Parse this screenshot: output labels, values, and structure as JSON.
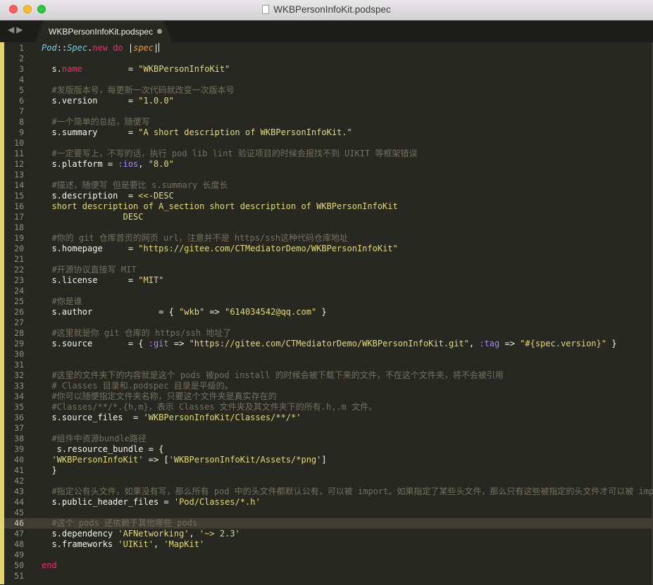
{
  "window": {
    "title": "WKBPersonInfoKit.podspec"
  },
  "tab": {
    "label": "WKBPersonInfoKit.podspec",
    "modified": true
  },
  "nav": {
    "back": "◀",
    "forward": "▶"
  },
  "colors": {
    "bg": "#272822",
    "keyword": "#f92672",
    "string": "#e6db74",
    "comment": "#75715e",
    "class": "#66d9ef",
    "param": "#fd971f",
    "symbol": "#ae81ff",
    "text": "#f8f8f2"
  },
  "editor": {
    "active_line": 46,
    "lines": [
      [
        [
          "Pod",
          "cls"
        ],
        [
          "::",
          "plain"
        ],
        [
          "Spec",
          "cls"
        ],
        [
          ".",
          "plain"
        ],
        [
          "new",
          "kw"
        ],
        [
          " ",
          "plain"
        ],
        [
          "do",
          "kw"
        ],
        [
          " |",
          "plain"
        ],
        [
          "spec",
          "param"
        ],
        [
          "|",
          "plain"
        ],
        [
          "",
          "cursor"
        ]
      ],
      [],
      [
        [
          "  s.",
          "plain"
        ],
        [
          "name",
          "kw"
        ],
        [
          "         = ",
          "plain"
        ],
        [
          "\"WKBPersonInfoKit\"",
          "str"
        ]
      ],
      [],
      [
        [
          "  #发版版本号，每更新一次代码就改变一次版本号",
          "cmt"
        ]
      ],
      [
        [
          "  s.version      = ",
          "plain"
        ],
        [
          "\"1.0.0\"",
          "str"
        ]
      ],
      [],
      [
        [
          "  #一个简单的总结，随便写",
          "cmt"
        ]
      ],
      [
        [
          "  s.summary      = ",
          "plain"
        ],
        [
          "\"A short description of WKBPersonInfoKit.\"",
          "str"
        ]
      ],
      [],
      [
        [
          "  #一定要写上，不写的话，执行 pod lib lint 验证项目的时候会报找不到 UIKIT 等框架错误",
          "cmt"
        ]
      ],
      [
        [
          "  s.platform = ",
          "plain"
        ],
        [
          ":ios",
          "sym"
        ],
        [
          ", ",
          "plain"
        ],
        [
          "\"8.0\"",
          "str"
        ]
      ],
      [],
      [
        [
          "  #描述，随便写 但是要比 s.summary 长度长",
          "cmt"
        ]
      ],
      [
        [
          "  s.description  = ",
          "plain"
        ],
        [
          "<<-DESC",
          "str"
        ]
      ],
      [
        [
          "  short description of A_section short description of WKBPersonInfoKit",
          "str"
        ]
      ],
      [
        [
          "                DESC",
          "str"
        ]
      ],
      [],
      [
        [
          "  #你的 git 仓库首页的网页 url，注意并不是 https/ssh这种代码仓库地址",
          "cmt"
        ]
      ],
      [
        [
          "  s.homepage     = ",
          "plain"
        ],
        [
          "\"https://gitee.com/CTMediatorDemo/WKBPersonInfoKit\"",
          "str"
        ]
      ],
      [],
      [
        [
          "  #开源协议直接写 MIT",
          "cmt"
        ]
      ],
      [
        [
          "  s.license      = ",
          "plain"
        ],
        [
          "\"MIT\"",
          "str"
        ]
      ],
      [],
      [
        [
          "  #你是谁",
          "cmt"
        ]
      ],
      [
        [
          "  s.author             = { ",
          "plain"
        ],
        [
          "\"wkb\"",
          "str"
        ],
        [
          " => ",
          "plain"
        ],
        [
          "\"614034542@qq.com\"",
          "str"
        ],
        [
          " }",
          "plain"
        ]
      ],
      [],
      [
        [
          "  #这里就是你 git 仓库的 https/ssh 地址了",
          "cmt"
        ]
      ],
      [
        [
          "  s.source       = { ",
          "plain"
        ],
        [
          ":git",
          "sym"
        ],
        [
          " => ",
          "plain"
        ],
        [
          "\"https://gitee.com/CTMediatorDemo/WKBPersonInfoKit.git\"",
          "str"
        ],
        [
          ", ",
          "plain"
        ],
        [
          ":tag",
          "sym"
        ],
        [
          " => ",
          "plain"
        ],
        [
          "\"#{spec.version}\"",
          "str"
        ],
        [
          " }",
          "plain"
        ]
      ],
      [],
      [],
      [
        [
          "  #这里的文件夹下的内容就是这个 pods 被pod install 的时候会被下载下来的文件，不在这个文件夹，将不会被引用",
          "cmt"
        ]
      ],
      [
        [
          "  # Classes 目录和.podspec 目录是平级的。",
          "cmt"
        ]
      ],
      [
        [
          "  #你可以随便指定文件夹名称，只要这个文件夹是真实存在的",
          "cmt"
        ]
      ],
      [
        [
          "  #Classes/**/*.{h,m}，表示 Classes 文件夹及其文件夹下的所有.h,.m 文件。",
          "cmt"
        ]
      ],
      [
        [
          "  s.source_files  = ",
          "plain"
        ],
        [
          "'WKBPersonInfoKit/Classes/**/*'",
          "str"
        ]
      ],
      [],
      [
        [
          "  #组件中资源bundle路径",
          "cmt"
        ]
      ],
      [
        [
          "   s.resource_bundle = {",
          "plain"
        ]
      ],
      [
        [
          "  ",
          "plain"
        ],
        [
          "'WKBPersonInfoKit'",
          "str"
        ],
        [
          " => [",
          "plain"
        ],
        [
          "'WKBPersonInfoKit/Assets/*png'",
          "str"
        ],
        [
          "]",
          "plain"
        ]
      ],
      [
        [
          "  }",
          "plain"
        ]
      ],
      [],
      [
        [
          "  #指定公有头文件，如果没有写，那么所有 pod 中的头文件都默认公有，可以被 import。如果指定了某些头文件，那么只有这些被指定的头文件才可以被 imp",
          "cmt"
        ]
      ],
      [
        [
          "  s.public_header_files = ",
          "plain"
        ],
        [
          "'Pod/Classes/*.h'",
          "str"
        ]
      ],
      [],
      [
        [
          "  #这个 pods 还依赖于其他哪些 pods",
          "cmt"
        ]
      ],
      [
        [
          "  s.dependency ",
          "plain"
        ],
        [
          "'AFNetworking'",
          "str"
        ],
        [
          ", ",
          "plain"
        ],
        [
          "'~> 2.3'",
          "str"
        ]
      ],
      [
        [
          "  s.frameworks ",
          "plain"
        ],
        [
          "'UIKit'",
          "str"
        ],
        [
          ", ",
          "plain"
        ],
        [
          "'MapKit'",
          "str"
        ]
      ],
      [],
      [
        [
          "end",
          "kw"
        ]
      ],
      []
    ]
  }
}
